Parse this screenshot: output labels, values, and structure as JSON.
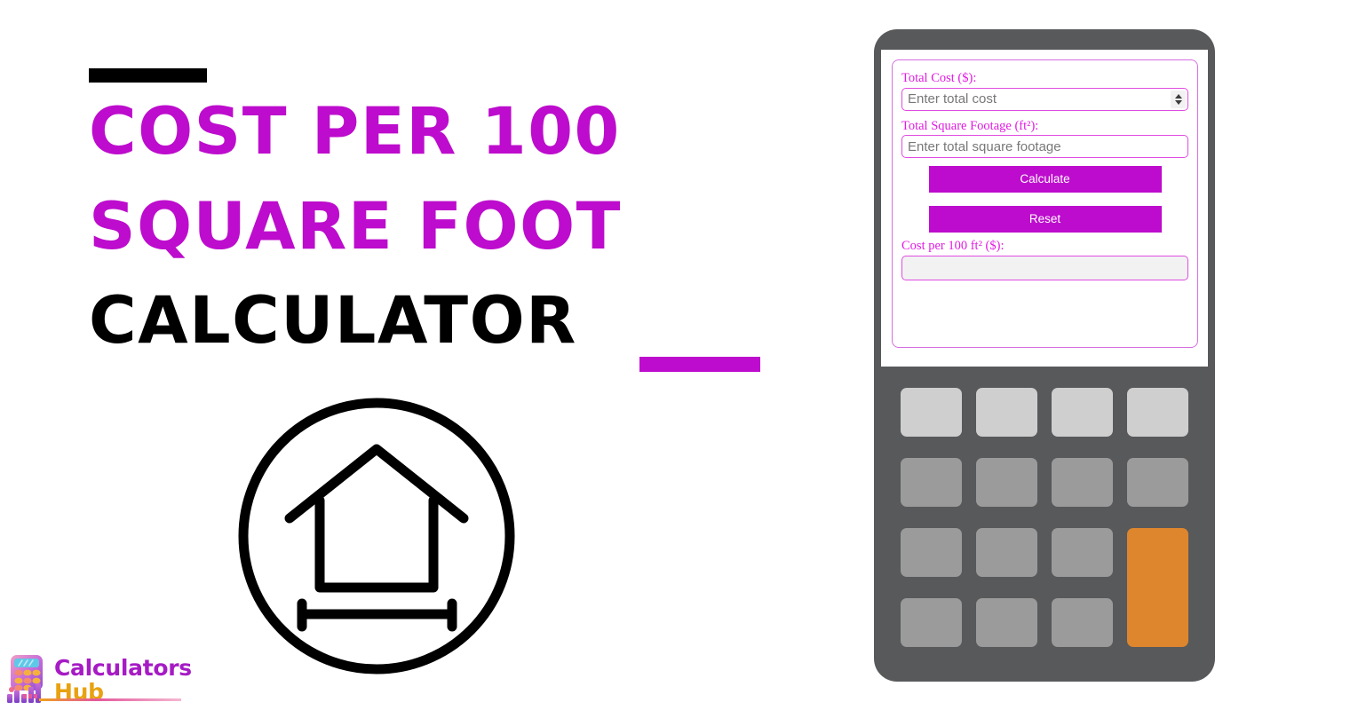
{
  "hero": {
    "title_lines": [
      "COST PER 100",
      "SQUARE FOOT",
      "CALCULATOR"
    ],
    "accent_color_purple": "#bd0ccd",
    "accent_color_black": "#000000",
    "icon": "house-measurement-icon"
  },
  "brand": {
    "line1": "Calculators",
    "line2": "Hub",
    "line1_color": "#a61bc4",
    "line2_color": "#e8a211",
    "mark": "calculator-bar-chart-logo-icon"
  },
  "device": {
    "frame_color": "#58595b",
    "screen_color": "#ffffff",
    "keypad": {
      "rows": 4,
      "cols": 4,
      "light_key_color": "#cfcfcf",
      "gray_key_color": "#9b9b9b",
      "accent_key_color": "#dd862e",
      "accent_key_position": "column-4-rows-3-4"
    }
  },
  "form": {
    "border_color": "#d66fe0",
    "accent_color": "#bd0ccd",
    "label_color": "#e21ae2",
    "fields": [
      {
        "id": "total-cost",
        "label": "Total Cost ($):",
        "placeholder": "Enter total cost",
        "value": "",
        "type": "number",
        "has_spinner": true
      },
      {
        "id": "total-square-footage",
        "label": "Total Square Footage (ft²):",
        "placeholder": "Enter total square footage",
        "value": "",
        "type": "text",
        "has_spinner": false
      }
    ],
    "buttons": [
      {
        "id": "calculate",
        "label": "Calculate"
      },
      {
        "id": "reset",
        "label": "Reset"
      }
    ],
    "result": {
      "label": "Cost per 100 ft² ($):",
      "value": "",
      "readonly": true,
      "background": "#f2f2f2"
    }
  }
}
